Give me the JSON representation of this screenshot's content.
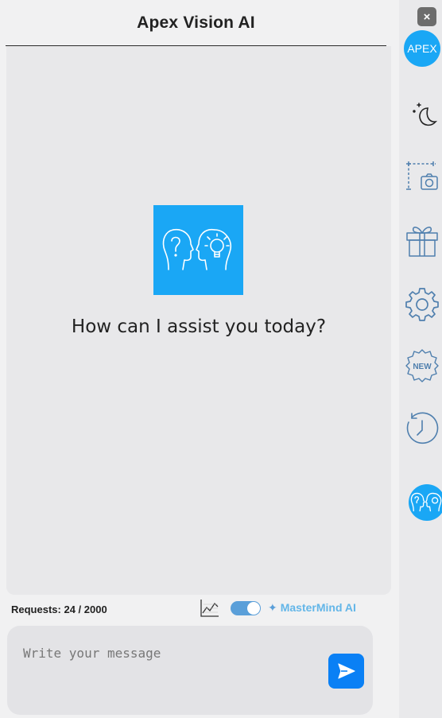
{
  "header": {
    "title": "Apex Vision AI"
  },
  "chat": {
    "welcome": "How can I assist you today?"
  },
  "status": {
    "requests_label": "Requests: 24 / 2000",
    "toggle_on": true,
    "mastermind_label": "MasterMind AI"
  },
  "composer": {
    "placeholder": "Write your message",
    "value": ""
  },
  "sidebar": {
    "close_glyph": "×",
    "apex_label": "APEX",
    "new_badge": "NEW",
    "icons": [
      "close-icon",
      "moon-stars-icon",
      "screenshot-icon",
      "gift-icon",
      "gear-icon",
      "new-badge-icon",
      "history-icon",
      "mastermind-icon"
    ]
  },
  "colors": {
    "brand": "#1aa7f5",
    "send": "#0a80f5",
    "icon_stroke": "#4f7fae"
  }
}
